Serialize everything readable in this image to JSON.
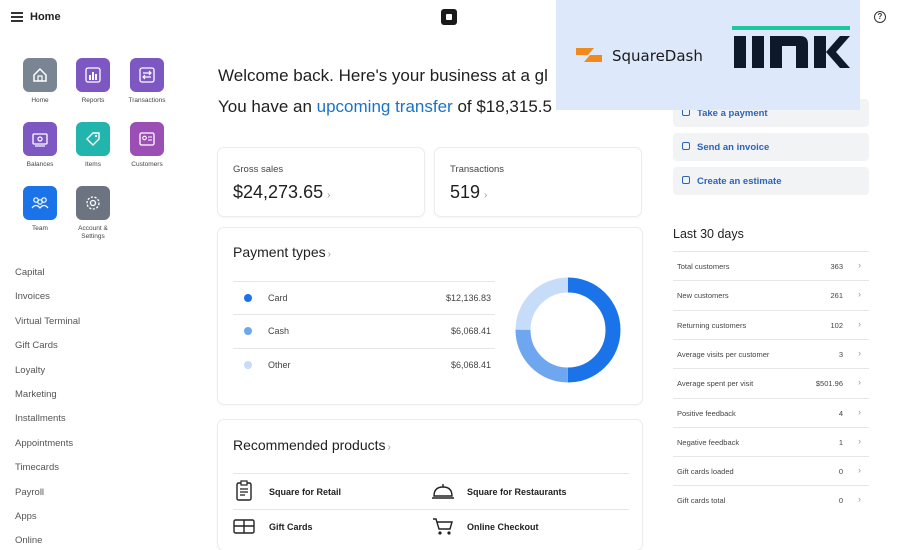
{
  "topbar": {
    "title": "Home"
  },
  "apps": [
    {
      "label": "Home",
      "color": "#7a8594"
    },
    {
      "label": "Reports",
      "color": "#7d57c2"
    },
    {
      "label": "Transactions",
      "color": "#7d57c2"
    },
    {
      "label": "Balances",
      "color": "#7d57c2"
    },
    {
      "label": "Items",
      "color": "#22b5ad"
    },
    {
      "label": "Customers",
      "color": "#9b4fb5"
    },
    {
      "label": "Team",
      "color": "#1a73e8"
    },
    {
      "label_line1": "Account &",
      "label_line2": "Settings",
      "color": "#6b7480"
    }
  ],
  "nav": [
    "Capital",
    "Invoices",
    "Virtual Terminal",
    "Gift Cards",
    "Loyalty",
    "Marketing",
    "Installments",
    "Appointments",
    "Timecards",
    "Payroll",
    "Apps",
    "Online"
  ],
  "main": {
    "welcome": "Welcome back. Here's your business at a gl",
    "transfer_prefix": "You have an ",
    "transfer_link": "upcoming transfer",
    "transfer_suffix": " of $18,315.5",
    "gross_sales_label": "Gross sales",
    "gross_sales_value": "$24,273.65",
    "transactions_label": "Transactions",
    "transactions_value": "519",
    "payment_types_title": "Payment types",
    "payment_types": [
      {
        "name": "Card",
        "amount": "$12,136.83",
        "share": 0.5,
        "color": "#1a73e8"
      },
      {
        "name": "Cash",
        "amount": "$6,068.41",
        "share": 0.25,
        "color": "#6ea6f0"
      },
      {
        "name": "Other",
        "amount": "$6,068.41",
        "share": 0.25,
        "color": "#c6dcf8"
      }
    ],
    "recommended_title": "Recommended products",
    "recommended": [
      "Square for Retail",
      "Square for Restaurants",
      "Gift Cards",
      "Online Checkout"
    ]
  },
  "actions": [
    "Take a payment",
    "Send an invoice",
    "Create an estimate"
  ],
  "last30": {
    "title": "Last 30 days",
    "metrics": [
      {
        "name": "Total customers",
        "value": "363"
      },
      {
        "name": "New customers",
        "value": "261"
      },
      {
        "name": "Returning customers",
        "value": "102"
      },
      {
        "name": "Average visits per customer",
        "value": "3"
      },
      {
        "name": "Average spent per visit",
        "value": "$501.96"
      },
      {
        "name": "Positive feedback",
        "value": "4"
      },
      {
        "name": "Negative feedback",
        "value": "1"
      },
      {
        "name": "Gift cards loaded",
        "value": "0"
      },
      {
        "name": "Gift cards total",
        "value": "0"
      }
    ]
  },
  "overlay": {
    "brand": "SquareDash",
    "brand_color": "#f08a1c",
    "logo_color": "#0d1a2b",
    "logo_accent": "#1fc79a"
  }
}
